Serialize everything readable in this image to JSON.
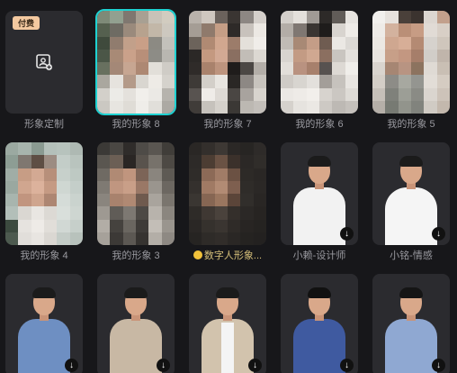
{
  "row1": [
    {
      "label": "形象定制",
      "badge": "付费",
      "icon": "add-avatar-icon"
    },
    {
      "label": "我的形象 8",
      "selected": true
    },
    {
      "label": "我的形象 7"
    },
    {
      "label": "我的形象 6"
    },
    {
      "label": "我的形象 5"
    }
  ],
  "row2": [
    {
      "label": "我的形象 4"
    },
    {
      "label": "我的形象 3"
    },
    {
      "label": "数字人形象..."
    },
    {
      "label": "小赖-设计师"
    },
    {
      "label": "小铭-情感"
    }
  ],
  "row3": [
    {
      "label": ""
    },
    {
      "label": ""
    },
    {
      "label": ""
    },
    {
      "label": ""
    },
    {
      "label": ""
    }
  ],
  "colors": {
    "background": "#17171a",
    "card": "#2b2b2f",
    "selected_outline": "#1fd2d2",
    "paid_badge": "#f4c9a0"
  }
}
